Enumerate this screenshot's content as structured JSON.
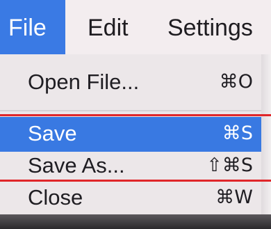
{
  "menubar": {
    "items": [
      {
        "label": "File",
        "active": true
      },
      {
        "label": "Edit",
        "active": false
      },
      {
        "label": "Settings",
        "active": false
      }
    ]
  },
  "file_menu": {
    "items": [
      {
        "label": "Open File...",
        "shortcut": "⌘O",
        "highlighted": false
      },
      {
        "label": "Save",
        "shortcut": "⌘S",
        "highlighted": true
      },
      {
        "label": "Save As...",
        "shortcut": "⇧⌘S",
        "highlighted": false
      },
      {
        "label": "Close",
        "shortcut": "⌘W",
        "highlighted": false
      }
    ]
  },
  "colors": {
    "menu_highlight": "#3979e2",
    "menubar_background": "#f3edef",
    "menu_background": "#ece7e9",
    "annotation_line": "#e0262a"
  }
}
